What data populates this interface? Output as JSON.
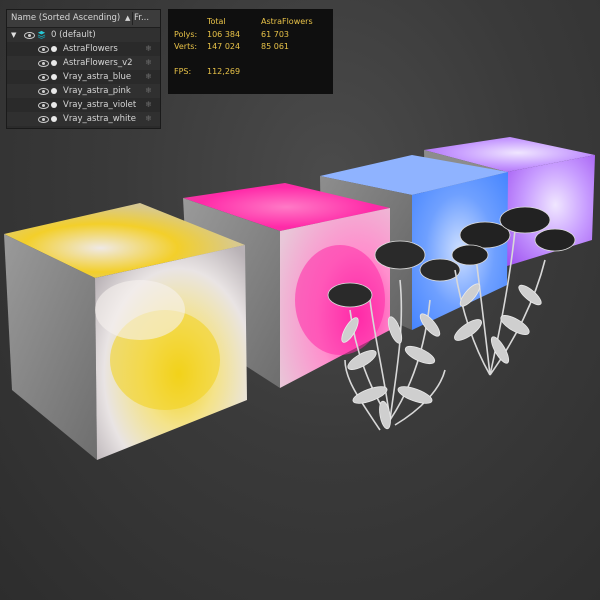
{
  "explorer": {
    "header": {
      "name_label": "Name (Sorted Ascending)",
      "sort_indicator": "▲",
      "frozen_label": "Fr..."
    },
    "layer": {
      "label": "0 (default)"
    },
    "items": [
      {
        "label": "AstraFlowers"
      },
      {
        "label": "AstraFlowers_v2"
      },
      {
        "label": "Vray_astra_blue"
      },
      {
        "label": "Vray_astra_pink"
      },
      {
        "label": "Vray_astra_violet"
      },
      {
        "label": "Vray_astra_white"
      }
    ]
  },
  "stats": {
    "col_total": "Total",
    "col_selected": "AstraFlowers",
    "polys_label": "Polys:",
    "polys_total": "106 384",
    "polys_selected": "61 703",
    "verts_label": "Verts:",
    "verts_total": "147 024",
    "verts_selected": "85 061",
    "fps_label": "FPS:",
    "fps_value": "112,269"
  },
  "colors": {
    "stats_text": "#e8c248",
    "cube_yellow": "#f2d21a",
    "cube_pink": "#ff2aa8",
    "cube_blue": "#3a7dff",
    "cube_violet": "#b05cff"
  },
  "icons": {
    "expand": "triangle-down-icon",
    "visibility": "eye-icon",
    "layer": "layer-stack-icon",
    "object": "object-dot-icon",
    "freeze": "snowflake-icon"
  }
}
